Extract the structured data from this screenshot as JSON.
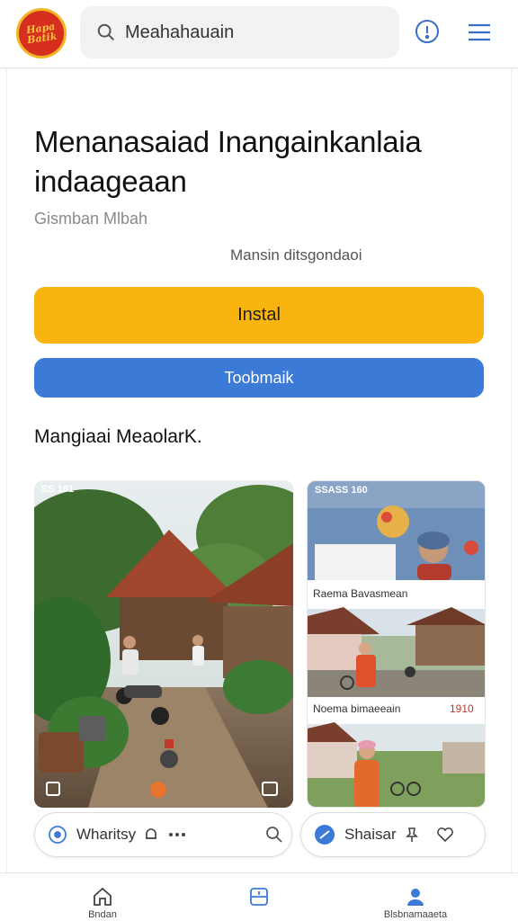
{
  "header": {
    "logo_text": "Hapa Batik",
    "search_placeholder": "Meahahauain",
    "icons": {
      "search": "search-icon",
      "info": "info-icon",
      "menu": "hamburger-menu-icon"
    }
  },
  "app": {
    "title": "Menanasaiad Inangainkanlaia indaageaan",
    "subtitle": "Gismban Mlbah",
    "meta": "Mansin ditsgondaoi"
  },
  "actions": {
    "install_label": "Instal",
    "bookmark_label": "Toobmaik"
  },
  "section": {
    "title": "Mangiaai MeaolarK."
  },
  "screenshots": {
    "main_status": "SS 161",
    "side_status": "SSASS 160",
    "side_captions": [
      {
        "text": "Raema Bavasmean",
        "num": ""
      },
      {
        "text": "Noema bimaeeain",
        "num": "1910"
      }
    ]
  },
  "share": {
    "left_label": "Wharitsy",
    "right_label": "Shaisar"
  },
  "bottom_nav": [
    {
      "label": "Bndan",
      "icon": "home-icon"
    },
    {
      "label": "",
      "icon": "apps-icon"
    },
    {
      "label": "Blsbnamaaeta",
      "icon": "profile-icon"
    }
  ],
  "colors": {
    "accent_yellow": "#f9b40f",
    "accent_blue": "#3b7ad6",
    "logo_red": "#d62e1f"
  }
}
